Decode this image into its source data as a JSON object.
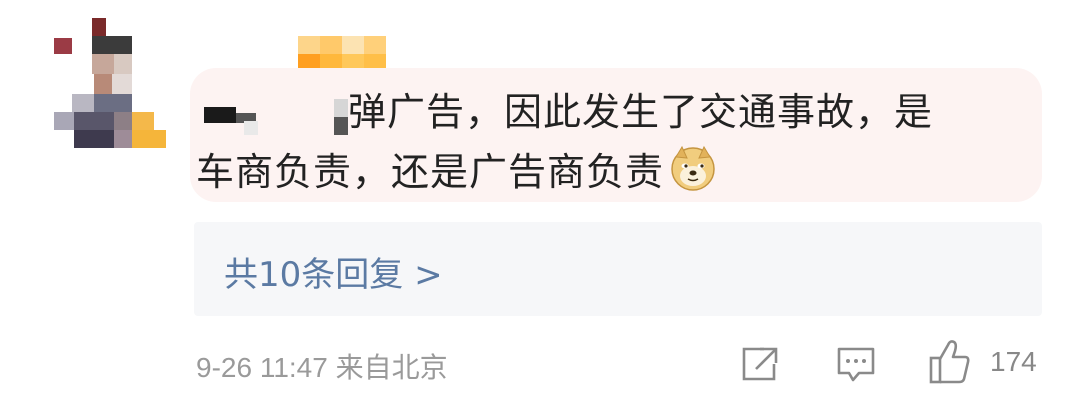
{
  "comment": {
    "text_line1": "弹广告，因此发生了交通事故，是",
    "text_line2": "车商负责，还是广告商负责",
    "emoji_icon": "doge-emoji-icon",
    "bubble_color": "#fdf3f2"
  },
  "replies": {
    "label": "共10条回复 >",
    "link_color": "#5b7aa3"
  },
  "footer": {
    "meta": "9-26 11:47  来自北京",
    "like_count": "174",
    "share_icon": "share-icon",
    "comment_icon": "comment-icon",
    "like_icon": "thumbs-up-icon"
  }
}
